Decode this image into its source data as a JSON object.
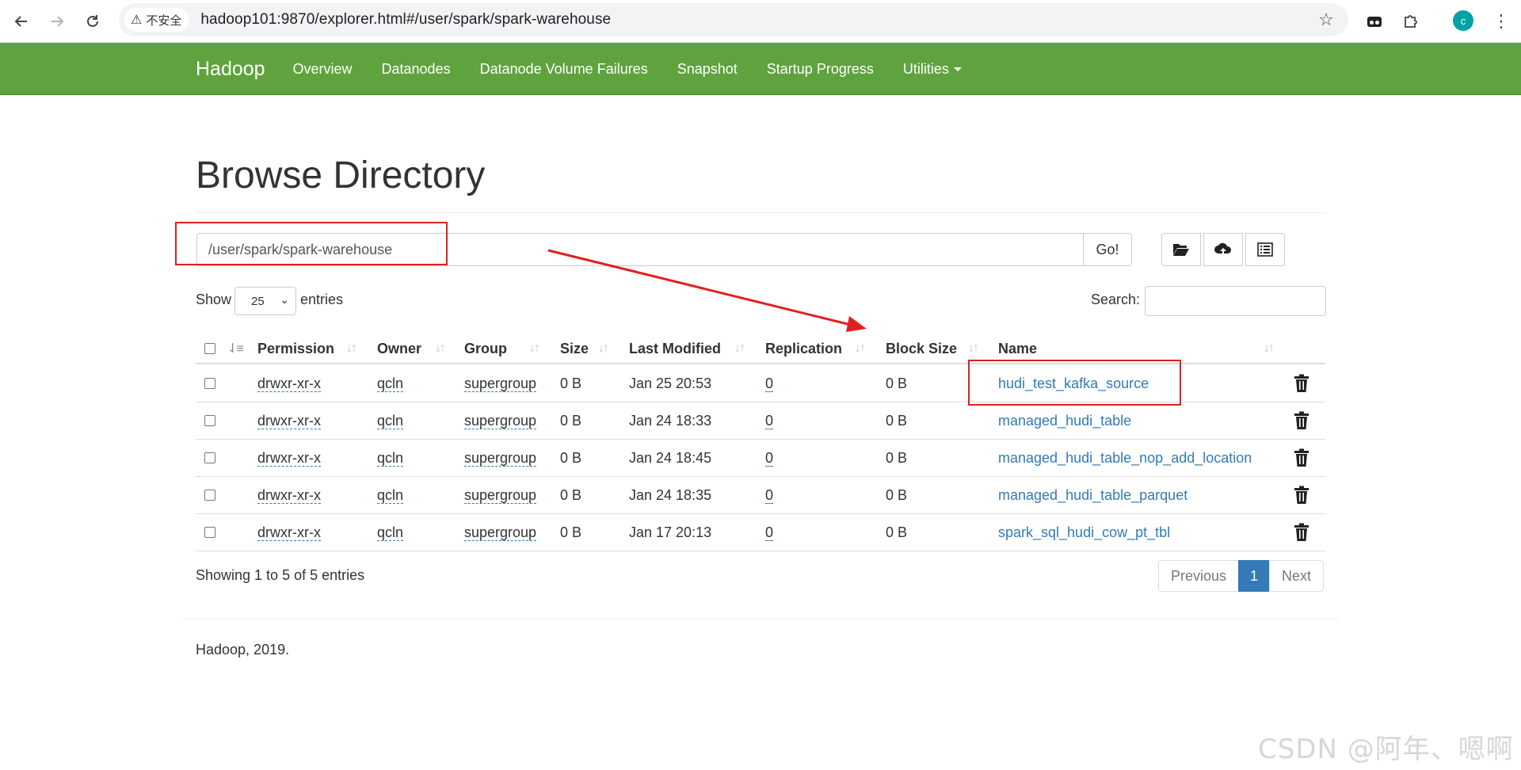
{
  "browser": {
    "security_label": "不安全",
    "url": "hadoop101:9870/explorer.html#/user/spark/spark-warehouse",
    "avatar_letter": "c"
  },
  "navbar": {
    "brand": "Hadoop",
    "items": [
      {
        "label": "Overview"
      },
      {
        "label": "Datanodes"
      },
      {
        "label": "Datanode Volume Failures"
      },
      {
        "label": "Snapshot"
      },
      {
        "label": "Startup Progress"
      },
      {
        "label": "Utilities",
        "dropdown": true
      }
    ]
  },
  "page": {
    "title": "Browse Directory",
    "path_value": "/user/spark/spark-warehouse",
    "go_label": "Go!"
  },
  "toolbar_icons": [
    "folder-open-icon",
    "cloud-upload-icon",
    "list-alt-icon"
  ],
  "datatable": {
    "show_label": "Show",
    "entries_value": "25",
    "entries_label": "entries",
    "search_label": "Search:",
    "columns": [
      "Permission",
      "Owner",
      "Group",
      "Size",
      "Last Modified",
      "Replication",
      "Block Size",
      "Name"
    ],
    "rows": [
      {
        "permission": "drwxr-xr-x",
        "owner": "qcln",
        "group": "supergroup",
        "size": "0 B",
        "modified": "Jan 25 20:53",
        "replication": "0",
        "block_size": "0 B",
        "name": "hudi_test_kafka_source"
      },
      {
        "permission": "drwxr-xr-x",
        "owner": "qcln",
        "group": "supergroup",
        "size": "0 B",
        "modified": "Jan 24 18:33",
        "replication": "0",
        "block_size": "0 B",
        "name": "managed_hudi_table"
      },
      {
        "permission": "drwxr-xr-x",
        "owner": "qcln",
        "group": "supergroup",
        "size": "0 B",
        "modified": "Jan 24 18:45",
        "replication": "0",
        "block_size": "0 B",
        "name": "managed_hudi_table_nop_add_location"
      },
      {
        "permission": "drwxr-xr-x",
        "owner": "qcln",
        "group": "supergroup",
        "size": "0 B",
        "modified": "Jan 24 18:35",
        "replication": "0",
        "block_size": "0 B",
        "name": "managed_hudi_table_parquet"
      },
      {
        "permission": "drwxr-xr-x",
        "owner": "qcln",
        "group": "supergroup",
        "size": "0 B",
        "modified": "Jan 17 20:13",
        "replication": "0",
        "block_size": "0 B",
        "name": "spark_sql_hudi_cow_pt_tbl"
      }
    ],
    "info": "Showing 1 to 5 of 5 entries",
    "pagination": {
      "previous": "Previous",
      "current": "1",
      "next": "Next"
    }
  },
  "footer": "Hadoop, 2019.",
  "watermark": "CSDN @阿年、嗯啊",
  "colors": {
    "navbar": "#5fa33e",
    "link": "#337ab7",
    "annotation": "#e02020"
  }
}
